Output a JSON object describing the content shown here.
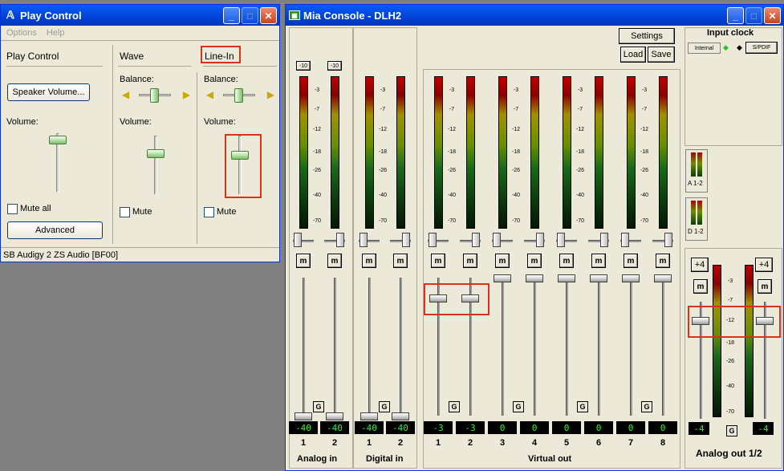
{
  "play_control": {
    "title": "Play Control",
    "menu": [
      "Options",
      "Help"
    ],
    "section_title": "Play Control",
    "speaker_volume_label": "Speaker Volume...",
    "volume_label": "Volume:",
    "mute_all_label": "Mute all",
    "advanced_label": "Advanced",
    "status": "SB Audigy 2 ZS Audio [BF00]",
    "columns": [
      {
        "title": "Wave",
        "balance_label": "Balance:",
        "volume_label": "Volume:",
        "mute_label": "Mute"
      },
      {
        "title": "Line-In",
        "balance_label": "Balance:",
        "volume_label": "Volume:",
        "mute_label": "Mute"
      }
    ]
  },
  "mia_console": {
    "title": "Mia Console - DLH2",
    "settings_label": "Settings",
    "load_label": "Load",
    "save_label": "Save",
    "input_clock_title": "Input clock",
    "internal_label": "Internal",
    "spdif_label": "S/PDIF",
    "small_meter_labels": [
      "A 1-2",
      "D 1-2"
    ],
    "db_labels": [
      "-3",
      "-7",
      "-12",
      "-18",
      "-26",
      "-40",
      "-70"
    ],
    "input_trim_labels": [
      "-10",
      "-10"
    ],
    "mute_label": "m",
    "g_label": "G",
    "groups": [
      "Analog in",
      "Digital in",
      "Virtual out"
    ],
    "channels": [
      {
        "num": "1",
        "value": "-40"
      },
      {
        "num": "2",
        "value": "-40"
      },
      {
        "num": "1",
        "value": "-40"
      },
      {
        "num": "2",
        "value": "-40"
      },
      {
        "num": "1",
        "value": "-3"
      },
      {
        "num": "2",
        "value": "-3"
      },
      {
        "num": "3",
        "value": "0"
      },
      {
        "num": "4",
        "value": "0"
      },
      {
        "num": "5",
        "value": "0"
      },
      {
        "num": "6",
        "value": "0"
      },
      {
        "num": "7",
        "value": "0"
      },
      {
        "num": "8",
        "value": "0"
      }
    ],
    "analog_out": {
      "title": "Analog out 1/2",
      "plus_labels": [
        "+4",
        "+4"
      ],
      "values": [
        "-4",
        "-4"
      ],
      "db_labels": [
        "-3",
        "-7",
        "-12",
        "-18",
        "-26",
        "-40",
        "-70"
      ]
    }
  },
  "colors": {
    "title_bar": "#0054e3",
    "highlight": "#d9341a",
    "readout_text": "#2cf12c",
    "window_bg": "#ece9d8"
  }
}
